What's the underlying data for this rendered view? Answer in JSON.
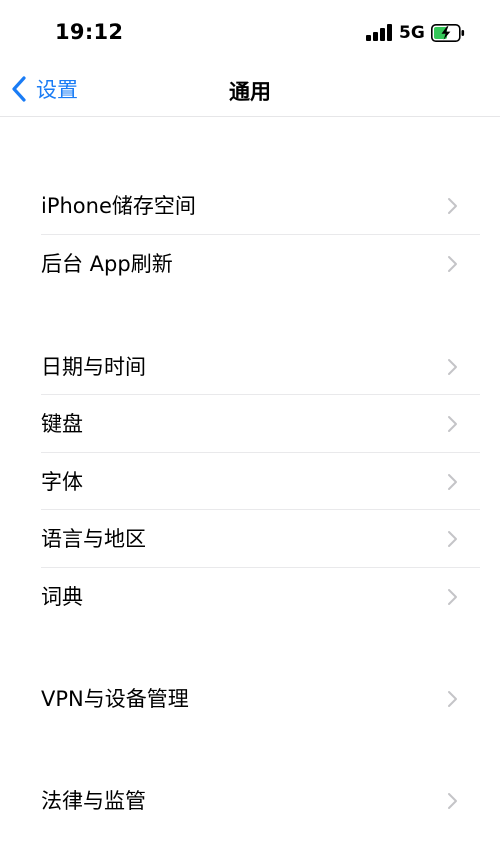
{
  "status_bar": {
    "time": "19:12",
    "network": "5G"
  },
  "nav": {
    "back_label": "设置",
    "title": "通用"
  },
  "sections": [
    [
      "iPhone储存空间",
      "后台 App刷新"
    ],
    [
      "日期与时间",
      "键盘",
      "字体",
      "语言与地区",
      "词典"
    ],
    [
      "VPN与设备管理"
    ],
    [
      "法律与监管"
    ]
  ],
  "colors": {
    "accent": "#1a7cf5",
    "chevron": "#c4c4c7",
    "battery_fill": "#34c759"
  }
}
